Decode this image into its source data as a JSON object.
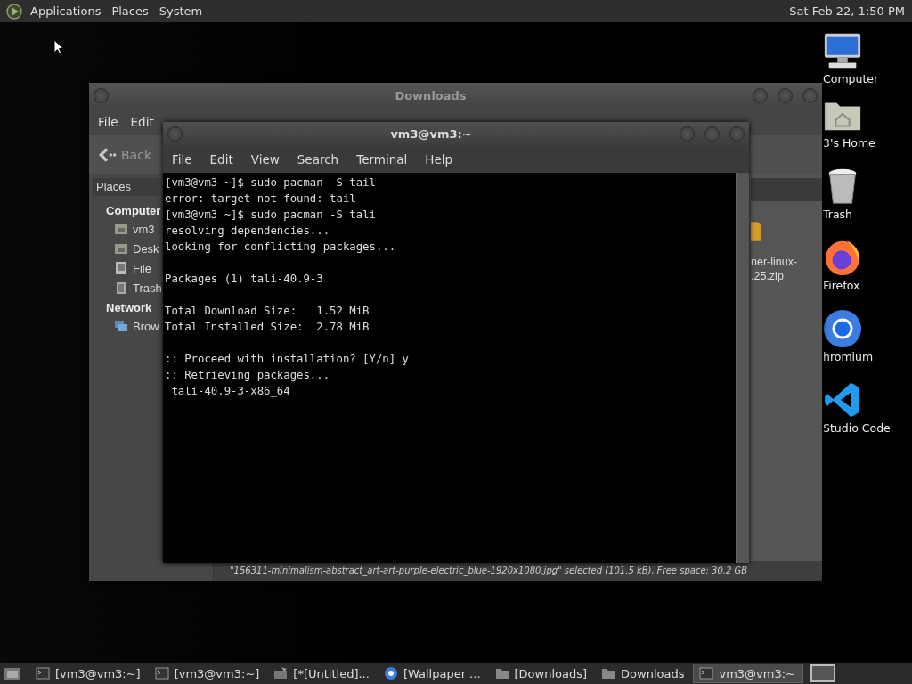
{
  "top_panel": {
    "menus": [
      "Applications",
      "Places",
      "System"
    ],
    "clock": "Sat Feb 22, 1:50 PM"
  },
  "desktop_icons": [
    {
      "kind": "computer",
      "label": "Computer"
    },
    {
      "kind": "home",
      "label": "3's Home"
    },
    {
      "kind": "trash",
      "label": "Trash"
    },
    {
      "kind": "firefox",
      "label": "Firefox"
    },
    {
      "kind": "chromium",
      "label": "hromium"
    },
    {
      "kind": "vscode",
      "label": "Studio Code"
    }
  ],
  "file_manager": {
    "title": "Downloads",
    "menus": [
      "File",
      "Edit"
    ],
    "back_button": "Back",
    "sidebar": {
      "header": "Places",
      "sections": [
        {
          "title": "Computer",
          "items": [
            {
              "kind": "home",
              "label": "vm3"
            },
            {
              "kind": "desktop",
              "label": "Desk"
            },
            {
              "kind": "drive",
              "label": "File"
            },
            {
              "kind": "trash",
              "label": "Trash"
            }
          ]
        },
        {
          "title": "Network",
          "items": [
            {
              "kind": "network",
              "label": "Brow"
            }
          ]
        }
      ]
    },
    "files": [
      {
        "kind": "archive",
        "name_lines": [
          "ner-linux-",
          ".25.zip"
        ]
      }
    ],
    "status": "\"156311-minimalism-abstract_art-art-purple-electric_blue-1920x1080.jpg\" selected (101.5 kB), Free space: 30.2 GB"
  },
  "terminal": {
    "title": "vm3@vm3:~",
    "menus": [
      "File",
      "Edit",
      "View",
      "Search",
      "Terminal",
      "Help"
    ],
    "output": "[vm3@vm3 ~]$ sudo pacman -S tail\nerror: target not found: tail\n[vm3@vm3 ~]$ sudo pacman -S tali\nresolving dependencies...\nlooking for conflicting packages...\n\nPackages (1) tali-40.9-3\n\nTotal Download Size:   1.52 MiB\nTotal Installed Size:  2.78 MiB\n\n:: Proceed with installation? [Y/n] y\n:: Retrieving packages...\n tali-40.9-3-x86_64"
  },
  "taskbar": {
    "items": [
      {
        "kind": "terminal",
        "label": "[vm3@vm3:~]",
        "selected": false
      },
      {
        "kind": "terminal",
        "label": "[vm3@vm3:~]",
        "selected": false
      },
      {
        "kind": "document",
        "label": "[*[Untitled]...",
        "selected": false
      },
      {
        "kind": "chromium",
        "label": "[Wallpaper ...",
        "selected": false
      },
      {
        "kind": "folder",
        "label": "[Downloads]",
        "selected": false
      },
      {
        "kind": "folder",
        "label": "Downloads",
        "selected": false
      },
      {
        "kind": "terminal",
        "label": "vm3@vm3:~",
        "selected": true
      }
    ]
  }
}
